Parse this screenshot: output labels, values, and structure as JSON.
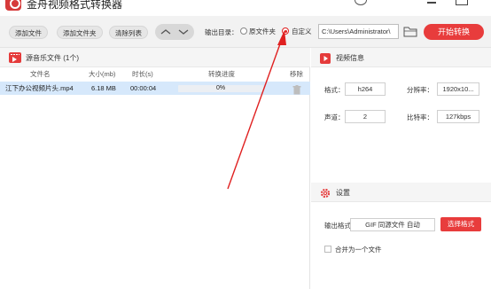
{
  "app": {
    "title": "金舟视频格式转换器"
  },
  "toolbar": {
    "add_file": "添加文件",
    "add_folder": "添加文件夹",
    "clear_list": "清除列表",
    "output_dir_label": "输出目录：",
    "radio_source_folder": "原文件夹",
    "radio_custom": "自定义",
    "output_path": "C:\\Users\\Administrator\\",
    "start_button": "开始转换"
  },
  "file_list": {
    "title": "源音乐文件 (1个)",
    "columns": {
      "name": "文件名",
      "size": "大小(mb)",
      "duration": "时长(s)",
      "progress": "转换进度",
      "remove": "移除"
    },
    "rows": [
      {
        "name": "江下办公视频片头.mp4",
        "size": "6.18 MB",
        "duration": "00:00:04",
        "progress_text": "0%",
        "progress_value": 0
      }
    ]
  },
  "video_info": {
    "title": "视频信息",
    "format_label": "格式：",
    "format_value": "h264",
    "resolution_label": "分辨率：",
    "resolution_value": "1920x10...",
    "channel_label": "声道：",
    "channel_value": "2",
    "bitrate_label": "比特率：",
    "bitrate_value": "127kbps"
  },
  "settings": {
    "title": "设置",
    "output_format_label": "输出格式：",
    "output_format_value": "GIF 同源文件 自动",
    "select_format_button": "选择格式",
    "merge_label": "合并为一个文件",
    "merge_checked": false
  },
  "colors": {
    "accent": "#e83c3c",
    "selected_row": "#d6e8fb",
    "toolbar_bg": "#f2f2f2"
  }
}
